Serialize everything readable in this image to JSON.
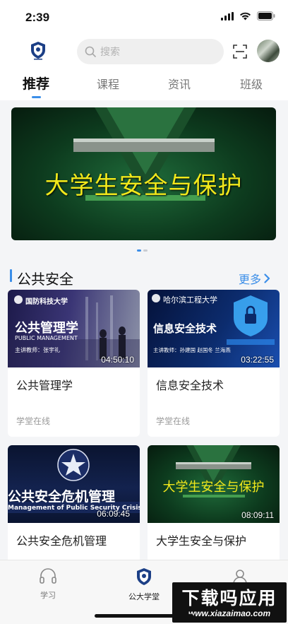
{
  "status": {
    "time": "2:39"
  },
  "header": {
    "search_placeholder": "搜索"
  },
  "tabs": [
    {
      "label": "推荐",
      "active": true
    },
    {
      "label": "课程",
      "active": false
    },
    {
      "label": "资讯",
      "active": false
    },
    {
      "label": "班级",
      "active": false
    }
  ],
  "banner": {
    "title": "大学生安全与保护",
    "slide_count": 2,
    "active_slide": 1
  },
  "section": {
    "title": "公共安全",
    "more_label": "更多"
  },
  "courses": [
    {
      "title": "公共管理学",
      "source": "学堂在线",
      "duration": "04:50:10",
      "thumb_lines": [
        "国防科技大学",
        "公共管理学",
        "PUBLIC MANAGEMENT",
        "主讲教师：张宇礼"
      ]
    },
    {
      "title": "信息安全技术",
      "source": "学堂在线",
      "duration": "03:22:55",
      "thumb_lines": [
        "哈尔滨工程大学",
        "信息安全技术",
        "主讲教师：孙建国 赵国冬 兰海燕"
      ]
    },
    {
      "title": "公共安全危机管理",
      "source": "",
      "duration": "06:09:45",
      "thumb_lines": [
        "公共安全危机管理",
        "Management of Public Security Crisis"
      ]
    },
    {
      "title": "大学生安全与保护",
      "source": "",
      "duration": "08:09:11",
      "thumb_lines": [
        "大学生安全与保护"
      ]
    }
  ],
  "bottom_nav": [
    {
      "label": "学习",
      "icon": "headphones-icon",
      "active": false
    },
    {
      "label": "公大学堂",
      "icon": "school-emblem-icon",
      "active": true
    },
    {
      "label": "",
      "icon": "profile-icon",
      "active": false
    }
  ],
  "watermark": {
    "main": "下载吗应用",
    "sub": "www.xiazaimao.com"
  },
  "colors": {
    "accent": "#3b8ee8",
    "banner_text": "#f1e81b"
  }
}
